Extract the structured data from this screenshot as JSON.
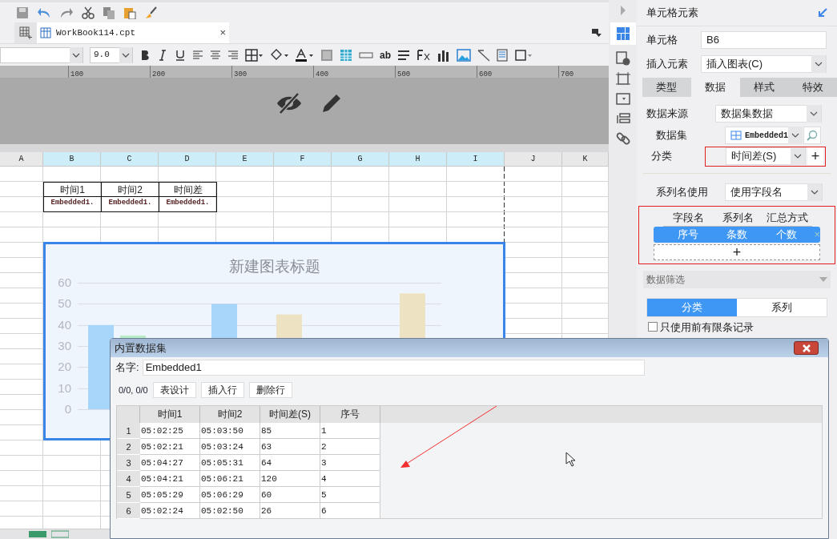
{
  "tab": {
    "title": "WorkBook114.cpt",
    "close_glyph": "×"
  },
  "format_bar": {
    "font_size": "9.0",
    "text_style_button": "ab"
  },
  "ruler": {
    "marks": [
      "100",
      "200",
      "300",
      "400",
      "500",
      "600",
      "700"
    ]
  },
  "sheet": {
    "columns": [
      "A",
      "B",
      "C",
      "D",
      "E",
      "F",
      "G",
      "H",
      "I",
      "J",
      "K"
    ],
    "header_cells": [
      "时间1",
      "时间2",
      "时间差"
    ],
    "data_cells": [
      "Embedded1.",
      "Embedded1.",
      "Embedded1."
    ]
  },
  "chart": {
    "title": "新建图表标题",
    "y_ticks": [
      "60",
      "50",
      "40",
      "30",
      "20",
      "10",
      "0"
    ]
  },
  "side_panel": {
    "title": "单元格元素",
    "cell_label": "单元格",
    "cell_value": "B6",
    "insert_label": "插入元素",
    "insert_value": "插入图表(C)",
    "tabs": [
      {
        "label": "类型",
        "selected": false
      },
      {
        "label": "数据",
        "selected": true
      },
      {
        "label": "样式",
        "selected": false
      },
      {
        "label": "特效",
        "selected": false
      }
    ],
    "data_source_label": "数据来源",
    "data_source_value": "数据集数据",
    "dataset_label": "数据集",
    "dataset_value": "Embedded1",
    "category_label": "分类",
    "category_value": "时间差(S)",
    "add_glyph": "+",
    "remove_glyph": "×",
    "add_field_glyph": "+",
    "series_name_label": "系列名使用",
    "series_name_value": "使用字段名",
    "field_columns": [
      "字段名",
      "系列名",
      "汇总方式"
    ],
    "field_rows": [
      {
        "cells": [
          "序号",
          "条数",
          "个数"
        ],
        "selected": true
      }
    ],
    "filter_title": "数据筛选",
    "filter_tabs": [
      {
        "label": "分类",
        "selected": true
      },
      {
        "label": "系列",
        "selected": false
      }
    ],
    "limit_checkbox": {
      "label": "只使用前有限条记录",
      "checked": false
    }
  },
  "dialog": {
    "title": "内置数据集",
    "name_label": "名字:",
    "name_value": "Embedded1",
    "position": "0/0, 0/0",
    "buttons": [
      "表设计",
      "插入行",
      "删除行"
    ],
    "columns": [
      "时间1",
      "时间2",
      "时间差(S)",
      "序号"
    ],
    "rows": [
      {
        "number": "1",
        "cells": [
          "05:02:25",
          "05:03:50",
          "85",
          "1"
        ]
      },
      {
        "number": "2",
        "cells": [
          "05:02:21",
          "05:03:24",
          "63",
          "2"
        ]
      },
      {
        "number": "3",
        "cells": [
          "05:04:27",
          "05:05:31",
          "64",
          "3"
        ]
      },
      {
        "number": "4",
        "cells": [
          "05:04:21",
          "05:06:21",
          "120",
          "4"
        ]
      },
      {
        "number": "5",
        "cells": [
          "05:05:29",
          "05:06:29",
          "60",
          "5"
        ]
      },
      {
        "number": "6",
        "cells": [
          "05:02:24",
          "05:02:50",
          "26",
          "6"
        ]
      }
    ]
  }
}
